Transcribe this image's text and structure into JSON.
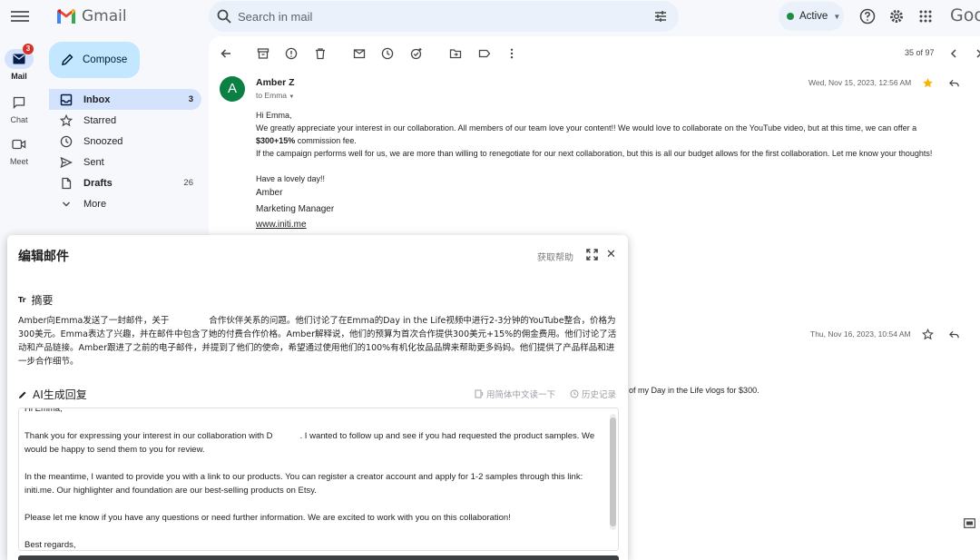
{
  "app": {
    "name": "Gmail",
    "google_partial": "Goo",
    "search_placeholder": "Search in mail",
    "status": "Active"
  },
  "rail": [
    {
      "label": "Mail",
      "badge": "3",
      "icon": "mail-icon"
    },
    {
      "label": "Chat",
      "icon": "chat-icon"
    },
    {
      "label": "Meet",
      "icon": "meet-icon"
    }
  ],
  "compose_label": "Compose",
  "nav": [
    {
      "label": "Inbox",
      "count": "3",
      "icon": "inbox-icon"
    },
    {
      "label": "Starred",
      "count": "",
      "icon": "star-icon"
    },
    {
      "label": "Snoozed",
      "count": "",
      "icon": "clock-icon"
    },
    {
      "label": "Sent",
      "count": "",
      "icon": "send-icon"
    },
    {
      "label": "Drafts",
      "count": "26",
      "icon": "drafts-icon"
    },
    {
      "label": "More",
      "count": "",
      "icon": "chevron-down-icon"
    }
  ],
  "toolbar": {
    "page_count": "35 of 97"
  },
  "email": {
    "avatar_letter": "A",
    "sender": "Amber Z",
    "to": "to Emma",
    "date": "Wed, Nov 15, 2023, 12:56 AM",
    "greeting": "Hi Emma,",
    "line1": "We greatly appreciate your interest in our collaboration. All members of our team love your content!! We would love to collaborate on the YouTube video, but at this time, we can offer a",
    "fee_bold": "$300+15%",
    "fee_rest": " commission fee.",
    "line3": "If the campaign performs well for us, we are more than willing to renegotiate for our next collaboration, but this is all our budget allows for the first collaboration. Let me know your thoughts!",
    "closing": "Have a lovely day!!",
    "sig_name": "Amber",
    "sig_title": "Marketing Manager",
    "sig_link": "www.initi.me"
  },
  "second_message": {
    "date": "Thu, Nov 16, 2023, 10:54 AM",
    "snippet": "of my Day in the Life vlogs for $300."
  },
  "panel": {
    "title": "编辑邮件",
    "help": "获取帮助",
    "summary_title": "摘要",
    "summary_a": "Amber向Emma发送了一封邮件，关于",
    "summary_b": "合作伙伴关系的问题。他们讨论了在Emma的Day in the Life视频中进行2-3分钟的YouTube整合，价格为300美元。Emma表达了兴趣，并在邮件中包含了她的付费合作价格。Amber解释说，他们的预算为首次合作提供300美元+15%的佣金费用。他们讨论了活动和产品链接。Amber跟进了之前的电子邮件，并提到了他们的使命，希望通过使用他们的100%有机化妆品品牌来帮助更多妈妈。他们提供了产品样品和进一步合作细节。",
    "reply_title": "AI生成回复",
    "read_chinese": "用简体中文读一下",
    "history": "历史记录",
    "reply": {
      "greeting": "Hi Emma,",
      "p1a": "Thank you for expressing your interest in our collaboration with D",
      "p1b": ". I wanted to follow up and see if you had requested the product samples. We would be happy to send them to you for review.",
      "p2": "In the meantime, I wanted to provide you with a link to our products. You can register a creator account and apply for 1-2 samples through this link: initi.me. Our highlighter and foundation are our best-selling products on Etsy.",
      "p3": "Please let me know if you have any questions or need further information. We are excited to work with you on this collaboration!",
      "signoff": "Best regards,"
    }
  },
  "colors": {
    "accent": "#c2e7ff",
    "active_nav": "#d3e3fd",
    "search_bg": "#eaf1fb",
    "status_green": "#1e8e3e",
    "badge_red": "#d93025",
    "star_yellow": "#f4b400",
    "avatar_green": "#0b8043"
  }
}
